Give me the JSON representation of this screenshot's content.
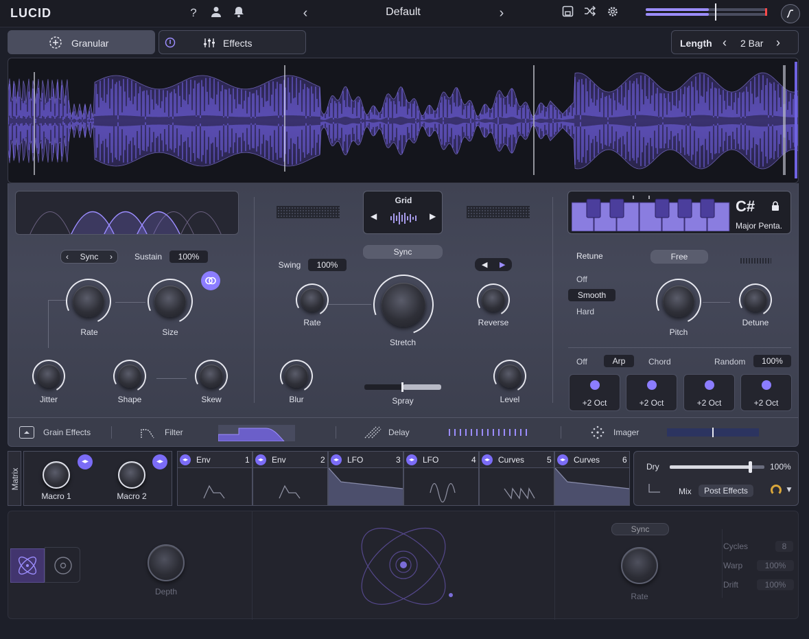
{
  "app": {
    "name": "LUCID",
    "preset": "Default"
  },
  "topbar_icons": [
    "help-icon",
    "user-icon",
    "bell-icon",
    "save-icon",
    "shuffle-icon",
    "gear-icon"
  ],
  "tabs": {
    "granular": "Granular",
    "effects": "Effects"
  },
  "length": {
    "label": "Length",
    "value": "2 Bar"
  },
  "grain": {
    "sync_label": "Sync",
    "sustain_label": "Sustain",
    "sustain_value": "100%",
    "rate": "Rate",
    "size": "Size",
    "jitter": "Jitter",
    "shape": "Shape",
    "skew": "Skew"
  },
  "playback": {
    "grid_label": "Grid",
    "sync_button": "Sync",
    "swing_label": "Swing",
    "swing_value": "100%",
    "rate": "Rate",
    "stretch": "Stretch",
    "reverse": "Reverse",
    "blur": "Blur",
    "spray": "Spray",
    "level": "Level"
  },
  "pitch": {
    "key": "C#",
    "scale": "Major Penta.",
    "retune_label": "Retune",
    "free_button": "Free",
    "retune_options": [
      "Off",
      "Smooth",
      "Hard"
    ],
    "retune_selected": "Smooth",
    "pitch": "Pitch",
    "detune": "Detune",
    "arp_options": [
      "Off",
      "Arp",
      "Chord"
    ],
    "arp_selected": "Arp",
    "random_label": "Random",
    "random_value": "100%",
    "octaves": [
      "+2 Oct",
      "+2 Oct",
      "+2 Oct",
      "+2 Oct"
    ]
  },
  "fx_bar": {
    "grain_effects": "Grain Effects",
    "filter": "Filter",
    "delay": "Delay",
    "imager": "Imager"
  },
  "matrix": {
    "title": "Matrix",
    "macros": [
      "Macro 1",
      "Macro 2"
    ],
    "modulators": [
      {
        "name": "Env",
        "num": "1"
      },
      {
        "name": "Env",
        "num": "2"
      },
      {
        "name": "LFO",
        "num": "3"
      },
      {
        "name": "LFO",
        "num": "4"
      },
      {
        "name": "Curves",
        "num": "5"
      },
      {
        "name": "Curves",
        "num": "6"
      }
    ]
  },
  "output": {
    "dry_label": "Dry",
    "dry_value": "100%",
    "mix_label": "Mix",
    "mix_mode": "Post Effects",
    "dry_level": 0.85
  },
  "orbit": {
    "depth": "Depth",
    "sync_button": "Sync",
    "rate": "Rate",
    "cycles_label": "Cycles",
    "cycles_value": "8",
    "warp_label": "Warp",
    "warp_value": "100%",
    "drift_label": "Drift",
    "drift_value": "100%"
  },
  "colors": {
    "accent": "#7b6cf6",
    "bg": "#1d1f29",
    "panel": "#434657"
  }
}
